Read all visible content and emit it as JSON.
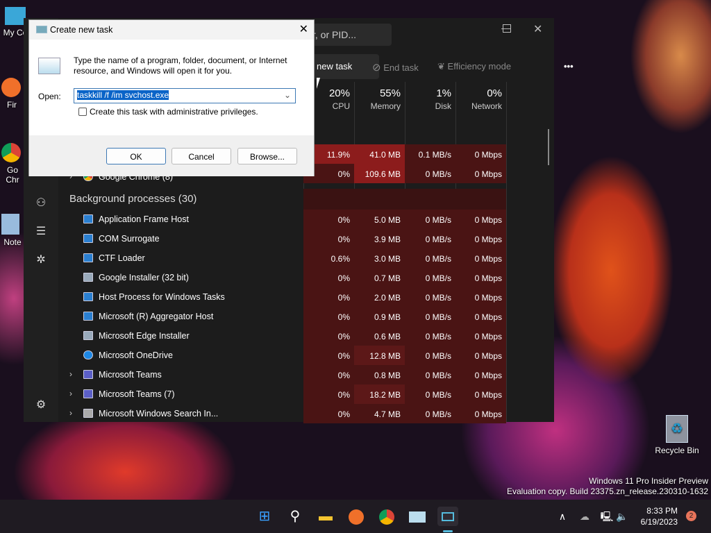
{
  "desktop": {
    "icons": [
      {
        "label": "My Co"
      },
      {
        "label": "Fir"
      },
      {
        "label": "Go Chr"
      },
      {
        "label": "Note"
      },
      {
        "label": "Recycle Bin"
      }
    ],
    "watermark": {
      "line1": "Windows 11 Pro Insider Preview",
      "line2": "Evaluation copy. Build 23375.zn_release.230310-1632"
    }
  },
  "task_manager": {
    "search_placeholder": "r, or PID...",
    "toolbar": {
      "run_new_task": "new task",
      "end_task": "End task",
      "efficiency_mode": "Efficiency mode",
      "more": "•••"
    },
    "columns": [
      {
        "pct": "20%",
        "label": "CPU"
      },
      {
        "pct": "55%",
        "label": "Memory"
      },
      {
        "pct": "1%",
        "label": "Disk"
      },
      {
        "pct": "0%",
        "label": "Network"
      }
    ],
    "top_rows": [
      {
        "name": "",
        "cpu": "11.9%",
        "mem": "41.0 MB",
        "disk": "0.1 MB/s",
        "net": "0 Mbps"
      },
      {
        "name": "Google Chrome (8)",
        "cpu": "0%",
        "mem": "109.6 MB",
        "disk": "0 MB/s",
        "net": "0 Mbps"
      }
    ],
    "group_title": "Background processes (30)",
    "rows": [
      {
        "name": "Application Frame Host",
        "cpu": "0%",
        "mem": "5.0 MB",
        "disk": "0 MB/s",
        "net": "0 Mbps",
        "icon": "window-icon",
        "expand": false
      },
      {
        "name": "COM Surrogate",
        "cpu": "0%",
        "mem": "3.9 MB",
        "disk": "0 MB/s",
        "net": "0 Mbps",
        "icon": "window-icon",
        "expand": false
      },
      {
        "name": "CTF Loader",
        "cpu": "0.6%",
        "mem": "3.0 MB",
        "disk": "0 MB/s",
        "net": "0 Mbps",
        "icon": "window-icon",
        "expand": false
      },
      {
        "name": "Google Installer (32 bit)",
        "cpu": "0%",
        "mem": "0.7 MB",
        "disk": "0 MB/s",
        "net": "0 Mbps",
        "icon": "installer-icon",
        "expand": false
      },
      {
        "name": "Host Process for Windows Tasks",
        "cpu": "0%",
        "mem": "2.0 MB",
        "disk": "0 MB/s",
        "net": "0 Mbps",
        "icon": "window-icon",
        "expand": false
      },
      {
        "name": "Microsoft (R) Aggregator Host",
        "cpu": "0%",
        "mem": "0.9 MB",
        "disk": "0 MB/s",
        "net": "0 Mbps",
        "icon": "window-icon",
        "expand": false
      },
      {
        "name": "Microsoft Edge Installer",
        "cpu": "0%",
        "mem": "0.6 MB",
        "disk": "0 MB/s",
        "net": "0 Mbps",
        "icon": "installer-icon",
        "expand": false
      },
      {
        "name": "Microsoft OneDrive",
        "cpu": "0%",
        "mem": "12.8 MB",
        "disk": "0 MB/s",
        "net": "0 Mbps",
        "icon": "cloud-icon",
        "expand": false
      },
      {
        "name": "Microsoft Teams",
        "cpu": "0%",
        "mem": "0.8 MB",
        "disk": "0 MB/s",
        "net": "0 Mbps",
        "icon": "teams-icon",
        "expand": true
      },
      {
        "name": "Microsoft Teams (7)",
        "cpu": "0%",
        "mem": "18.2 MB",
        "disk": "0 MB/s",
        "net": "0 Mbps",
        "icon": "teams-icon",
        "expand": true
      },
      {
        "name": "Microsoft Windows Search In...",
        "cpu": "0%",
        "mem": "4.7 MB",
        "disk": "0 MB/s",
        "net": "0 Mbps",
        "icon": "search-indexer-icon",
        "expand": true
      }
    ]
  },
  "dialog": {
    "title": "Create new task",
    "description": "Type the name of a program, folder, document, or Internet resource, and Windows will open it for you.",
    "open_label": "Open:",
    "open_value": "taskkill /f /im svchost.exe",
    "admin_checkbox": "Create this task with administrative privileges.",
    "admin_checked": false,
    "ok": "OK",
    "cancel": "Cancel",
    "browse": "Browse..."
  },
  "taskbar": {
    "time": "8:33 PM",
    "date": "6/19/2023",
    "notification_count": "2"
  }
}
